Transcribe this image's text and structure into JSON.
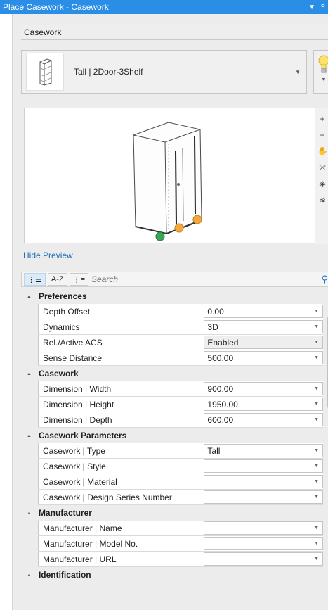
{
  "window": {
    "title": "Place Casework - Casework",
    "menu_glyph": "▼",
    "pin_glyph": "ꟼ"
  },
  "category_combo": {
    "value": "Casework",
    "arrow": "▾"
  },
  "type_selector": {
    "label": "Tall | 2Door-3Shelf",
    "arrow": "▼"
  },
  "bulb": {
    "arrow": "▼"
  },
  "preview": {
    "tools": [
      {
        "name": "zoom-in-icon",
        "glyph": "+"
      },
      {
        "name": "zoom-out-icon",
        "glyph": "−"
      },
      {
        "name": "pan-hand-icon",
        "glyph": "✋"
      },
      {
        "name": "fit-view-icon",
        "glyph": "⤧"
      },
      {
        "name": "view-cube-icon",
        "glyph": "◈"
      },
      {
        "name": "display-style-icon",
        "glyph": "≋"
      }
    ]
  },
  "hide_preview_label": "Hide Preview",
  "toolbar": {
    "categorized_label": "⋮☰",
    "az_label": "A-Z",
    "favorites_label": "⋮≡",
    "search_placeholder": "Search",
    "search_glyph": "⚲"
  },
  "colors": {
    "title_bar": "#2b8ee6",
    "link": "#1f6fb8",
    "panel_bg": "#ececec",
    "handle_green": "#3aa757",
    "handle_orange": "#f2a93b"
  },
  "properties": {
    "preferences": {
      "title": "Preferences",
      "rows": [
        {
          "name": "Depth Offset",
          "value": "0.00",
          "arrow": "▼"
        },
        {
          "name": "Dynamics",
          "value": "3D",
          "arrow": "▼"
        },
        {
          "name": "Rel./Active ACS",
          "value": "Enabled",
          "arrow": "▼"
        },
        {
          "name": "Sense Distance",
          "value": "500.00",
          "arrow": "▼"
        }
      ]
    },
    "casework": {
      "title": "Casework",
      "rows": [
        {
          "name": "Dimension | Width",
          "value": "900.00",
          "arrow": "▼"
        },
        {
          "name": "Dimension | Height",
          "value": "1950.00",
          "arrow": "▼"
        },
        {
          "name": "Dimension | Depth",
          "value": "600.00",
          "arrow": "▼"
        }
      ]
    },
    "casework_parameters": {
      "title": "Casework Parameters",
      "rows": [
        {
          "name": "Casework | Type",
          "value": "Tall",
          "arrow": "▼"
        },
        {
          "name": "Casework | Style",
          "value": "",
          "arrow": "▼"
        },
        {
          "name": "Casework | Material",
          "value": "",
          "arrow": "▼"
        },
        {
          "name": "Casework | Design Series Number",
          "value": "",
          "arrow": "▼"
        }
      ]
    },
    "manufacturer": {
      "title": "Manufacturer",
      "rows": [
        {
          "name": "Manufacturer | Name",
          "value": "",
          "arrow": "▼"
        },
        {
          "name": "Manufacturer | Model No.",
          "value": "",
          "arrow": "▼"
        },
        {
          "name": "Manufacturer | URL",
          "value": "",
          "arrow": "▼"
        }
      ]
    },
    "identification": {
      "title": "Identification"
    }
  }
}
